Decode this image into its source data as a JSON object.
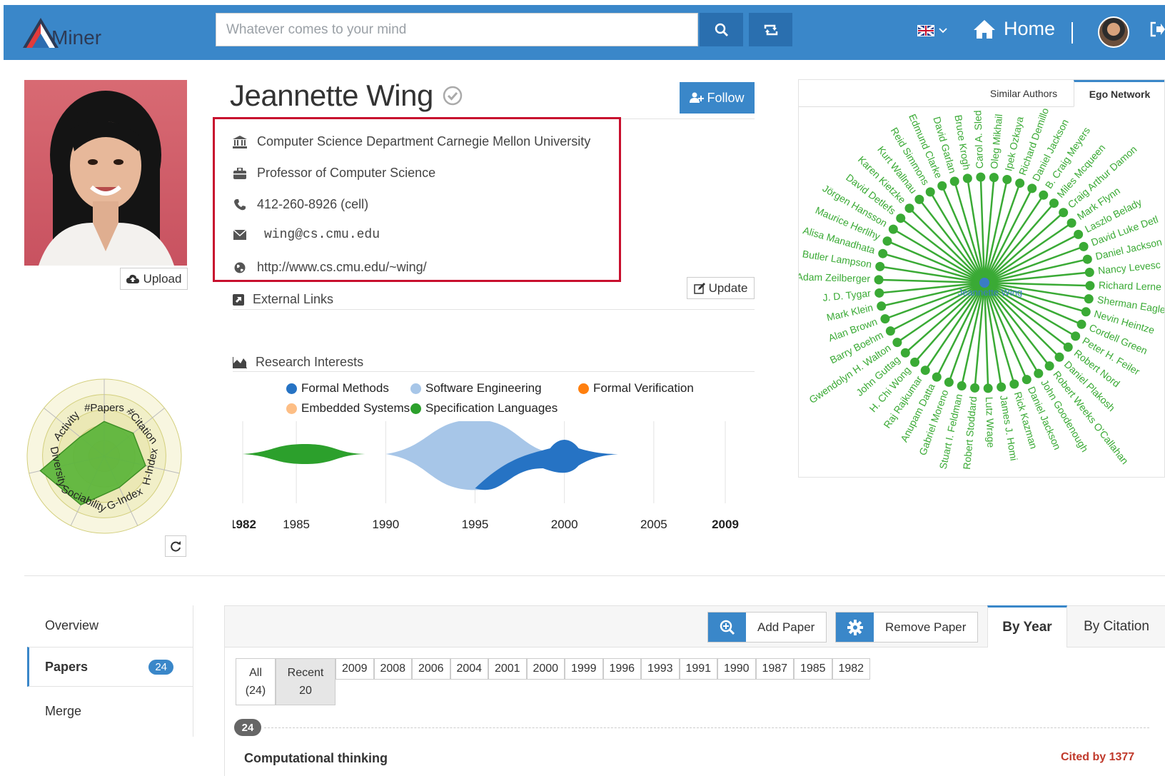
{
  "nav": {
    "logo_text": "Miner",
    "search_placeholder": "Whatever comes to your mind",
    "home_label": "Home"
  },
  "profile": {
    "name": "Jeannette Wing",
    "upload_label": "Upload",
    "follow_label": "Follow",
    "affiliation": "Computer Science Department Carnegie Mellon University",
    "position": "Professor of Computer Science",
    "phone": "412-260-8926 (cell)",
    "email": "wing@cs.cmu.edu",
    "homepage": "http://www.cs.cmu.edu/~wing/",
    "update_label": "Update",
    "external_links_label": "External Links"
  },
  "radar": {
    "axes": [
      "#Papers",
      "#Citation",
      "H-Index",
      "G-Index",
      "Sociability",
      "Diversity",
      "Activity"
    ],
    "values": [
      0.45,
      0.48,
      0.55,
      0.45,
      0.7,
      0.85,
      0.4
    ]
  },
  "research": {
    "title": "Research Interests",
    "chart_data": {
      "type": "area",
      "title": "Research Interests",
      "series": [
        {
          "name": "Formal Methods",
          "color": "#2673c4",
          "intervals": [
            [
              1995,
              2003
            ]
          ]
        },
        {
          "name": "Software Engineering",
          "color": "#a7c6e8",
          "intervals": [
            [
              1990,
              2000
            ]
          ]
        },
        {
          "name": "Formal Verification",
          "color": "#ff7f0e",
          "intervals": []
        },
        {
          "name": "Embedded Systems",
          "color": "#fdbe85",
          "intervals": []
        },
        {
          "name": "Specification Languages",
          "color": "#2ca02c",
          "intervals": [
            [
              1982,
              1989
            ]
          ]
        }
      ],
      "x_ticks": [
        "1982",
        "1985",
        "1990",
        "1995",
        "2000",
        "2005",
        "2009"
      ],
      "xlim": [
        1982,
        2009
      ]
    }
  },
  "ego": {
    "tab_similar": "Similar Authors",
    "tab_ego": "Ego Network",
    "center": "Jeannette Wing",
    "color": "#3aaa35",
    "nodes": [
      "Carol A. Sled",
      "Oleg Mikhail",
      "Ipek Ozkaya",
      "Richard Demillo",
      "Daniel Jackson",
      "B. Craig Meyers",
      "Miles Mcqueen",
      "Craig Arthur Damon",
      "Mark Flynn",
      "Laszlo Belady",
      "David Luke Detl",
      "Daniel Jackson",
      "Nancy Levesc",
      "Richard Lerne",
      "Sherman Eagle",
      "Nevin Heintze",
      "Cordell Green",
      "Peter H. Feiler",
      "Robert Nord",
      "Daniel Plakosh",
      "Robert Weeks O'Callahan",
      "John Goodenough",
      "Daniel Jackson",
      "Rick Kazman",
      "James J. Homi",
      "Lutz Wrage",
      "Robert Stoddard",
      "Stuart I. Feldman",
      "Gabriel Moreno",
      "Anupam Datta",
      "Raj Rajkumar",
      "H. Chi Wong",
      "John Guttag",
      "Gwendolyn H. Walton",
      "Barry Boehm",
      "Alan Brown",
      "Mark Klein",
      "J. D. Tygar",
      "Adam Zeilberger",
      "Butler Lampson",
      "Alisa Manadhata",
      "Maurice Herlihy",
      "Jörgen Hansson",
      "David Detlefs",
      "Karen Kietzke",
      "Kurt Wallnau",
      "Reid Simmons",
      "Edmund Clarke",
      "David Garlan",
      "Bruce Krogh"
    ]
  },
  "papers": {
    "side_nav": [
      {
        "label": "Overview"
      },
      {
        "label": "Papers",
        "badge": "24"
      },
      {
        "label": "Merge"
      }
    ],
    "add_paper": "Add Paper",
    "remove_paper": "Remove Paper",
    "sort_by_year": "By Year",
    "sort_by_citation": "By Citation",
    "filter_all": {
      "label": "All",
      "count": "(24)"
    },
    "filter_recent": {
      "label": "Recent",
      "count": "20"
    },
    "years": [
      "2009",
      "2008",
      "2006",
      "2004",
      "2001",
      "2000",
      "1999",
      "1996",
      "1993",
      "1991",
      "1990",
      "1987",
      "1985",
      "1982"
    ],
    "group_count": "24",
    "first_paper_title": "Computational thinking",
    "first_paper_cited": "Cited by 1377"
  }
}
